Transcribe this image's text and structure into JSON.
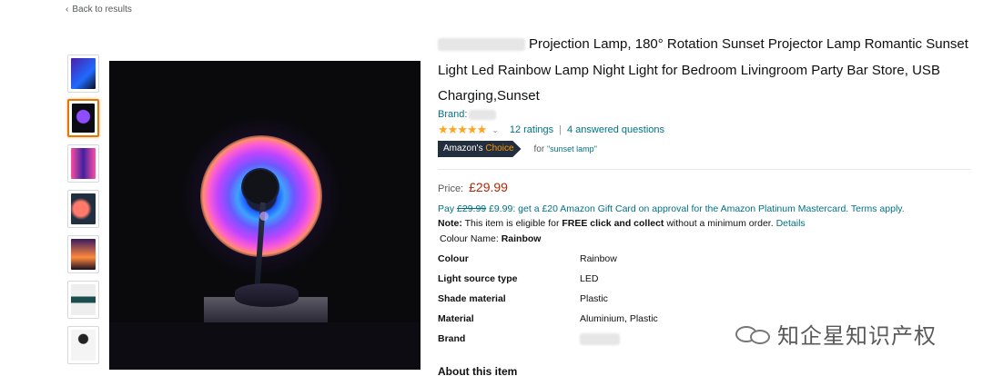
{
  "nav": {
    "back_label": "Back to results"
  },
  "thumbnails": [
    {
      "label": "thumbnail-1",
      "colors": [
        "#4b1ea8",
        "#1f6bff"
      ]
    },
    {
      "label": "thumbnail-2",
      "colors": [
        "#0b0b12",
        "#8f4dff"
      ]
    },
    {
      "label": "thumbnail-3",
      "colors": [
        "#ff4fa3",
        "#4020a0"
      ]
    },
    {
      "label": "thumbnail-4",
      "colors": [
        "#ff7a6a",
        "#203040"
      ]
    },
    {
      "label": "thumbnail-5",
      "colors": [
        "#ff8a3c",
        "#3a1a60"
      ]
    },
    {
      "label": "thumbnail-6",
      "colors": [
        "#eeeeee",
        "#1a4d4d"
      ]
    },
    {
      "label": "thumbnail-7",
      "colors": [
        "#f4f4f4",
        "#222222"
      ]
    }
  ],
  "product": {
    "title": "Projection Lamp, 180° Rotation Sunset Projector Lamp Romantic Sunset Light Led Rainbow Lamp Night Light for Bedroom Livingroom Party Bar Store, USB Charging,Sunset",
    "brand_label": "Brand:",
    "stars": "★★★★★",
    "ratings": "12 ratings",
    "questions": "4 answered questions",
    "separator": "|",
    "choice_badge_prefix": "Amazon's",
    "choice_badge_suffix": "Choice",
    "choice_for": "for",
    "choice_keyword": "\"sunset lamp\"",
    "price_label": "Price:",
    "price": "£29.99",
    "pay_prefix": "Pay",
    "pay_old": "£29.99",
    "pay_new": "£9.99",
    "pay_rest": ": get a £20 Amazon Gift Card on approval for the Amazon Platinum Mastercard. Terms apply.",
    "note_label": "Note:",
    "note_text_1": "This item is eligible for",
    "note_bold": "FREE click and collect",
    "note_text_2": "without a minimum order.",
    "note_link": "Details",
    "colour_label": "Colour Name:",
    "colour_value": "Rainbow",
    "about": "About this item"
  },
  "specs": [
    {
      "key": "Colour",
      "value": "Rainbow"
    },
    {
      "key": "Light source type",
      "value": "LED"
    },
    {
      "key": "Shade material",
      "value": "Plastic"
    },
    {
      "key": "Material",
      "value": "Aluminium, Plastic"
    },
    {
      "key": "Brand",
      "value": ""
    }
  ],
  "watermark": {
    "text": "知企星知识产权"
  },
  "colors": {
    "link": "#007185",
    "price": "#b12704",
    "star": "#ffa41c",
    "badge": "#232f3e",
    "accent": "#ff9900"
  }
}
